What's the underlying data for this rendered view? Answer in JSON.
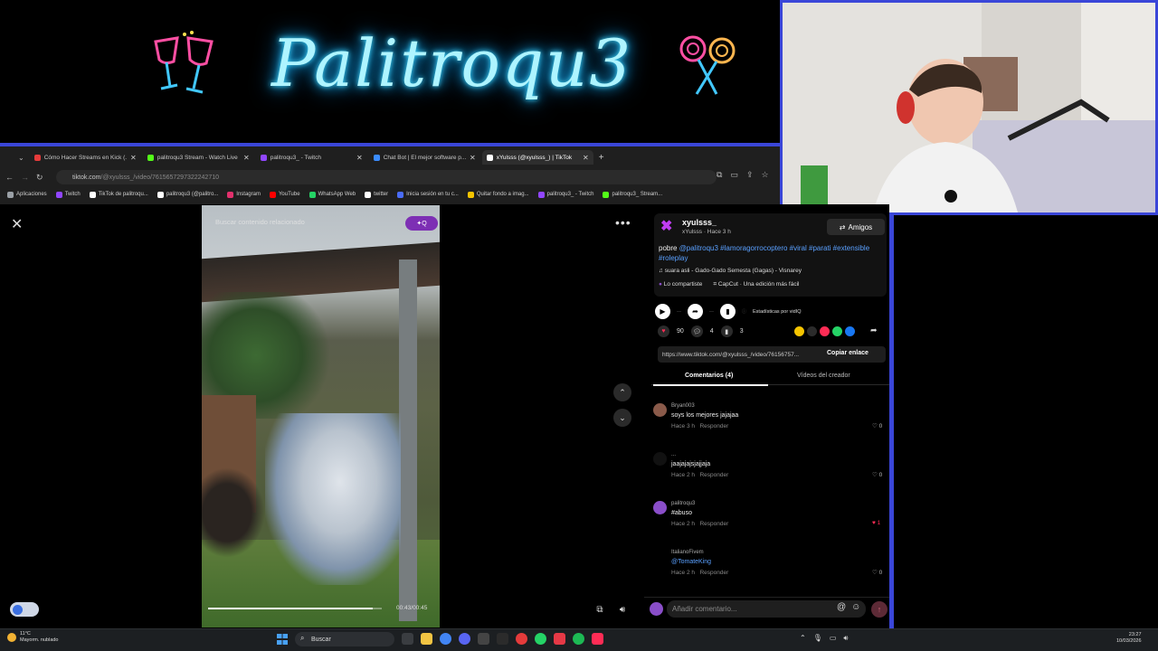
{
  "banner": {
    "logo_text": "Palitroqu3"
  },
  "browser": {
    "tabs": [
      {
        "label": "Cómo Hacer Streams en Kick (...",
        "color": "#e53b3b"
      },
      {
        "label": "palitroqu3 Stream - Watch Live",
        "color": "#53fc18"
      },
      {
        "label": "palitroqu3_ - Twitch",
        "color": "#9146ff"
      },
      {
        "label": "Chat Bot | El mejor software p...",
        "color": "#3a8cff"
      },
      {
        "label": "xYulsss (@xyulsss_) | TikTok",
        "color": "#ffffff"
      }
    ],
    "url_host": "tiktok.com",
    "url_path": "/@xyulsss_/video/7615657297322242710",
    "bookmarks": [
      {
        "label": "Aplicaciones",
        "color": "#9aa0a6"
      },
      {
        "label": "Twitch",
        "color": "#9146ff"
      },
      {
        "label": "TikTok de palitroqu...",
        "color": "#ffffff"
      },
      {
        "label": "palitroqu3 (@palitro...",
        "color": "#ffffff"
      },
      {
        "label": "Instagram",
        "color": "#e1306c"
      },
      {
        "label": "YouTube",
        "color": "#ff0000"
      },
      {
        "label": "WhatsApp Web",
        "color": "#25d366"
      },
      {
        "label": "twitter",
        "color": "#ffffff"
      },
      {
        "label": "Inicia sesión en tu c...",
        "color": "#4a6cf7"
      },
      {
        "label": "Quitar fondo a imag...",
        "color": "#f5c400"
      },
      {
        "label": "palitroqu3_ - Twitch",
        "color": "#9146ff"
      },
      {
        "label": "palitroqu3_ Stream...",
        "color": "#53fc18"
      }
    ]
  },
  "video": {
    "search_placeholder": "Buscar contenido relacionado",
    "search_button": "✦Q",
    "time": "00:43/00:45",
    "progress": 0.95
  },
  "author": {
    "username": "xyulsss_",
    "meta": "xYulsss · Hace 3 h",
    "friends_label": "Amigos",
    "caption_prefix": "pobre ",
    "caption_tags": "@palitroqu3 #lamoragorrocoptero #viral #parati #extensible #roleplay",
    "music": "suara asli - Gado-Gado Semesta (Gagas) - Visnarey",
    "shared": "Lo compartiste",
    "capcut": "CapCut · Una edición más fácil",
    "stats_label": "Estadísticas por vidIQ",
    "likes": "90",
    "comments": "4",
    "saves": "3",
    "link": "https://www.tiktok.com/@xyulsss_/video/76156757...",
    "copy_link": "Copiar enlace"
  },
  "tabs2": {
    "comments": "Comentarios (4)",
    "creator": "Vídeos del creador"
  },
  "comments": [
    {
      "user": "Bryan003",
      "text": "soys los mejores jajajaa",
      "time": "Hace 3 h",
      "reply": "Responder",
      "likes": "0",
      "liked": false,
      "color": "#8a5a4a",
      "mention": false
    },
    {
      "user": "...",
      "text": "jaajajajsjajjaja",
      "time": "Hace 2 h",
      "reply": "Responder",
      "likes": "0",
      "liked": false,
      "color": "#111111",
      "mention": false
    },
    {
      "user": "palitroqu3",
      "text": "#abuso",
      "time": "Hace 2 h",
      "reply": "Responder",
      "likes": "1",
      "liked": true,
      "color": "#8a4ec9",
      "mention": false
    },
    {
      "user": "ItalianoFivem",
      "text": "@TomateKing",
      "time": "Hace 2 h",
      "reply": "Responder",
      "likes": "0",
      "liked": false,
      "color": "#000000",
      "mention": true
    }
  ],
  "comment_input": {
    "placeholder": "Añadir comentario..."
  },
  "taskbar": {
    "weather_temp": "11°C",
    "weather_desc": "Mayorm. nublado",
    "search": "Buscar",
    "time": "23:27",
    "date": "10/03/2026"
  }
}
